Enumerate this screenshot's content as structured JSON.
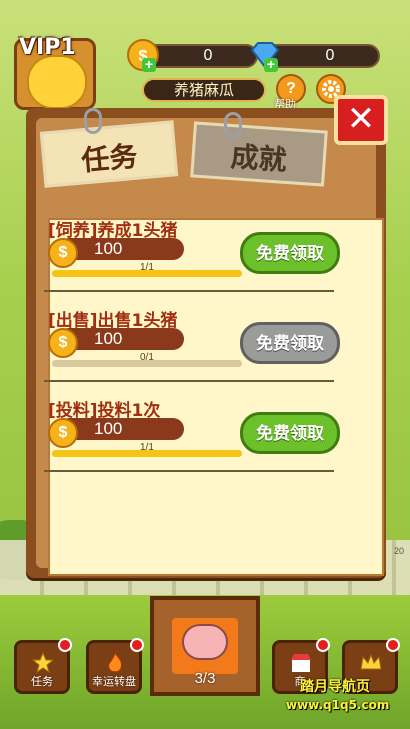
{
  "header": {
    "vip_label": "VIP1",
    "coins": "0",
    "gems": "0",
    "farm_name": "养猪麻瓜",
    "help_label": "帮助"
  },
  "dialog": {
    "tabs": [
      {
        "label": "任务",
        "active": true
      },
      {
        "label": "成就",
        "active": false
      }
    ],
    "close_symbol": "✕",
    "tasks": [
      {
        "title": "[饲养]养成1头猪",
        "reward": "100",
        "progress_text": "1/1",
        "progress": 1.0,
        "claim_label": "免费领取",
        "claim_enabled": true
      },
      {
        "title": "[出售]出售1头猪",
        "reward": "100",
        "progress_text": "0/1",
        "progress": 0.0,
        "claim_label": "免费领取",
        "claim_enabled": false
      },
      {
        "title": "[投料]投料1次",
        "reward": "100",
        "progress_text": "1/1",
        "progress": 1.0,
        "claim_label": "免费领取",
        "claim_enabled": true
      }
    ]
  },
  "background": {
    "side_number": "20"
  },
  "bottom_nav": {
    "task_label": "任务",
    "wheel_label": "幸运转盘",
    "pig_count": "3/3",
    "shop_label": "商",
    "vip_label": ""
  },
  "watermark": {
    "line1": "踏月导航页",
    "line2": "www.q1q5.com"
  },
  "colors": {
    "accent_green": "#6cc12a",
    "disabled_gray": "#9a9c9a",
    "close_red": "#d71f1f"
  }
}
